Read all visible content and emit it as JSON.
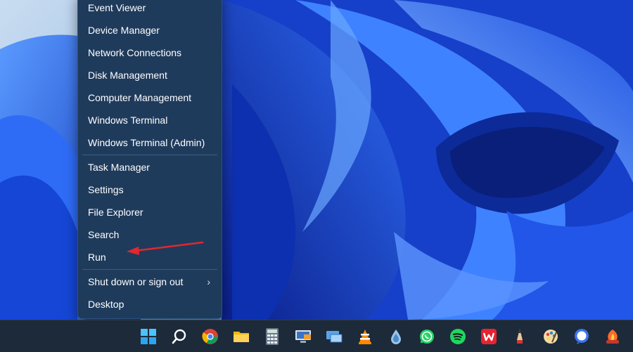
{
  "context_menu": {
    "items": [
      {
        "label": "Event Viewer"
      },
      {
        "label": "Device Manager"
      },
      {
        "label": "Network Connections"
      },
      {
        "label": "Disk Management"
      },
      {
        "label": "Computer Management"
      },
      {
        "label": "Windows Terminal"
      },
      {
        "label": "Windows Terminal (Admin)"
      },
      {
        "label": "Task Manager"
      },
      {
        "label": "Settings"
      },
      {
        "label": "File Explorer"
      },
      {
        "label": "Search"
      },
      {
        "label": "Run"
      },
      {
        "label": "Shut down or sign out",
        "submenu": true
      },
      {
        "label": "Desktop"
      }
    ],
    "submenu_chevron": "›"
  },
  "annotation": {
    "color": "#e0282e"
  },
  "taskbar": {
    "icons": [
      "windows-start-icon",
      "search-icon",
      "chrome-icon",
      "file-explorer-icon",
      "calculator-icon",
      "remote-desktop-icon",
      "connect-icon",
      "vlc-icon",
      "water-drop-icon",
      "whatsapp-icon",
      "spotify-icon",
      "wps-office-icon",
      "pencil-icon",
      "paint-icon",
      "chat-bubble-icon",
      "game-icon"
    ]
  },
  "colors": {
    "menu_bg": "#1f3b5c",
    "taskbar_bg": "#1c2a3a",
    "accent": "#1a5ff2"
  }
}
